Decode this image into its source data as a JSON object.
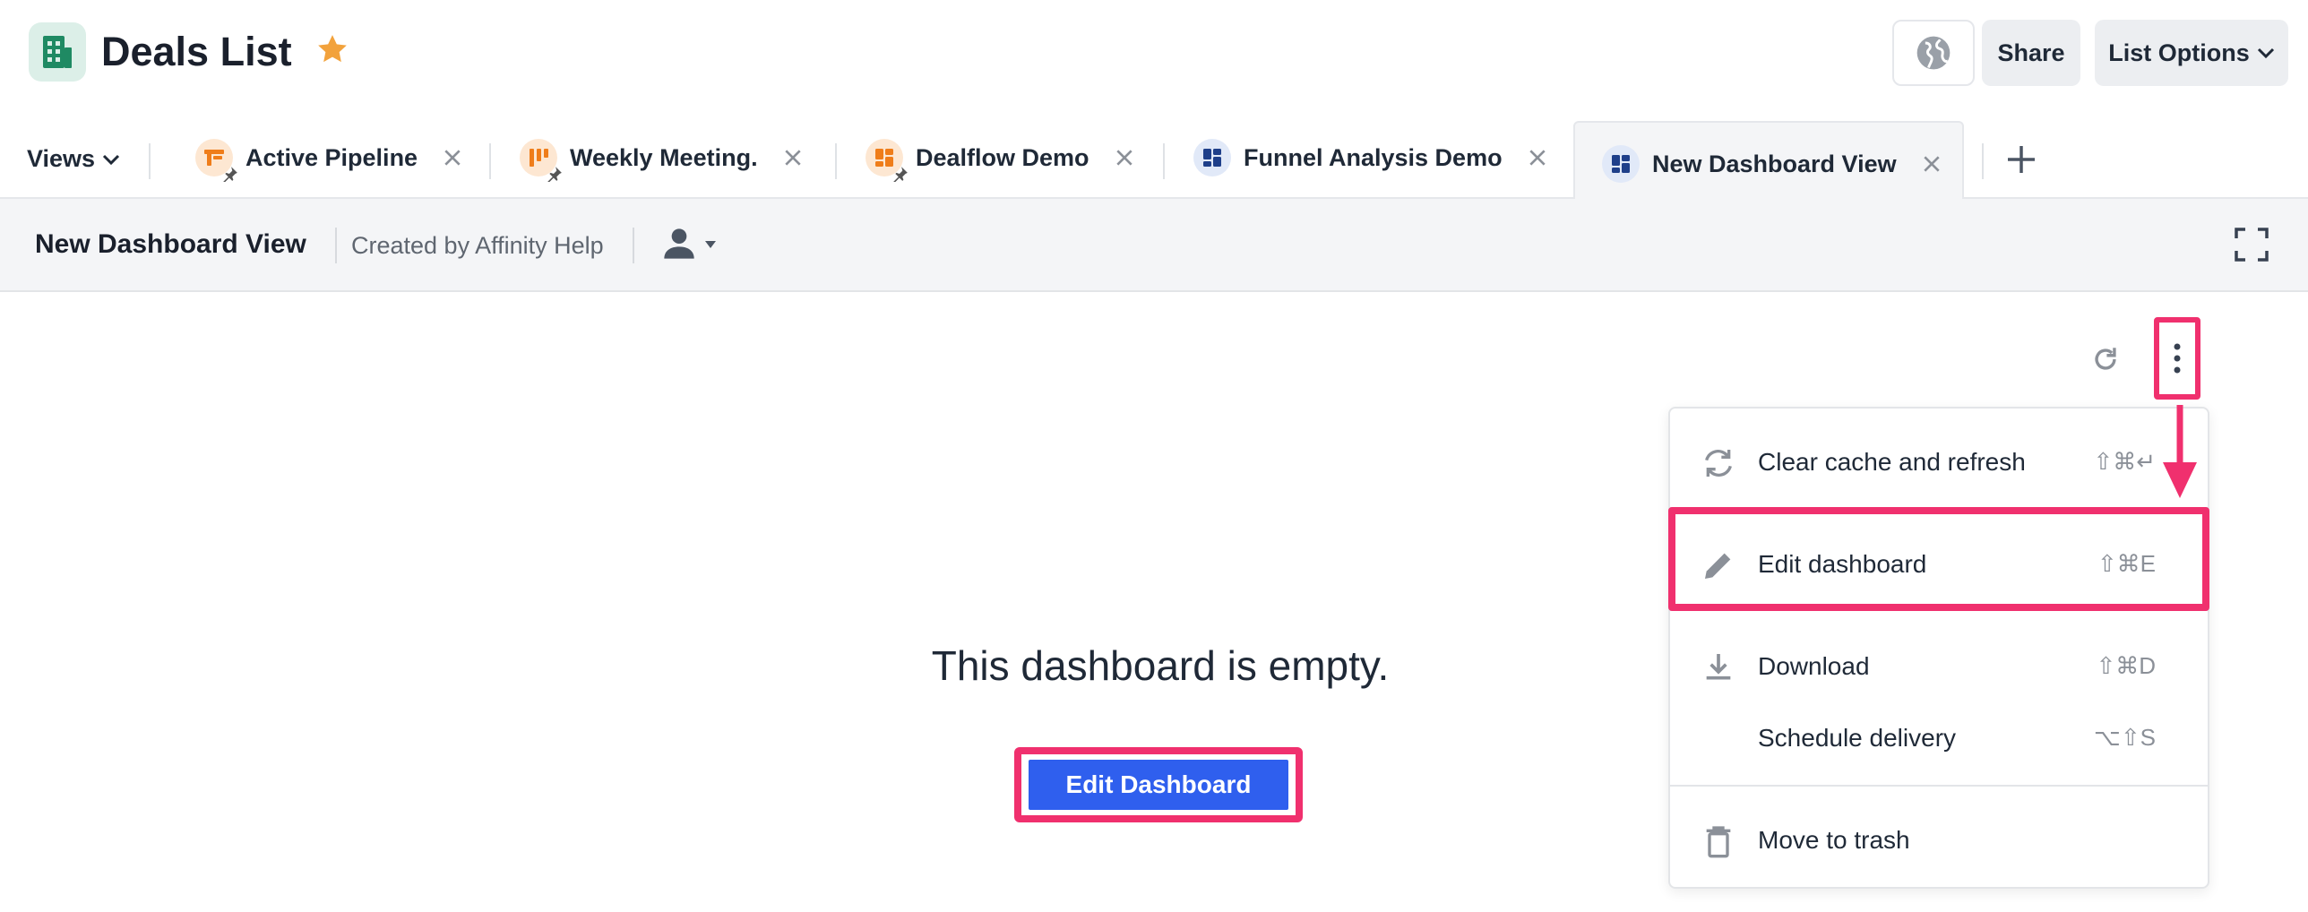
{
  "header": {
    "title": "Deals List",
    "share_label": "Share",
    "list_options_label": "List Options"
  },
  "tabs": {
    "views_label": "Views",
    "items": [
      {
        "label": "Active Pipeline"
      },
      {
        "label": "Weekly Meeting."
      },
      {
        "label": "Dealflow Demo"
      },
      {
        "label": "Funnel Analysis Demo"
      },
      {
        "label": "New Dashboard View"
      }
    ],
    "active_index": 4
  },
  "toolbar": {
    "view_title": "New Dashboard View",
    "created_by": "Created by Affinity Help"
  },
  "main": {
    "empty_message": "This dashboard is empty.",
    "edit_button_label": "Edit Dashboard"
  },
  "menu": {
    "items": [
      {
        "label": "Clear cache and refresh",
        "shortcut": "⇧⌘↵",
        "icon": "refresh-arrows-icon"
      },
      {
        "label": "Edit dashboard",
        "shortcut": "⇧⌘E",
        "icon": "pencil-icon"
      },
      {
        "label": "Download",
        "shortcut": "⇧⌘D",
        "icon": "download-icon"
      },
      {
        "label": "Schedule delivery",
        "shortcut": "⌥⇧S",
        "icon": ""
      },
      {
        "label": "Move to trash",
        "shortcut": "",
        "icon": "trash-icon"
      }
    ]
  },
  "colors": {
    "accent_blue": "#2f5fee",
    "highlight_pink": "#f0306e",
    "star_orange": "#f2a23c",
    "list_icon_green": "#1f8a63"
  }
}
